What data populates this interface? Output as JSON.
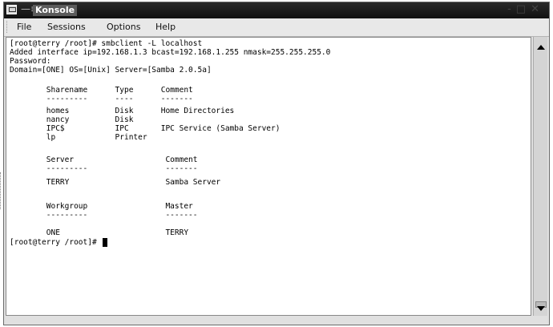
{
  "window": {
    "title": "Konsole"
  },
  "menu": {
    "file": "File",
    "sessions": "Sessions",
    "options": "Options",
    "help": "Help"
  },
  "terminal": {
    "lines": [
      "[root@terry /root]# smbclient -L localhost",
      "Added interface ip=192.168.1.3 bcast=192.168.1.255 nmask=255.255.255.0",
      "Password:",
      "Domain=[ONE] OS=[Unix] Server=[Samba 2.0.5a]",
      "",
      "        Sharename      Type      Comment",
      "        ---------      ----      -------",
      "        homes          Disk      Home Directories",
      "        nancy          Disk",
      "        IPC$           IPC       IPC Service (Samba Server)",
      "        lp             Printer",
      "",
      "        Server                    Comment",
      "        ---------                 -------",
      "        TERRY                     Samba Server",
      "",
      "        Workgroup                 Master",
      "        ---------                 -------",
      "        ONE                       TERRY",
      "[root@terry /root]# "
    ]
  }
}
